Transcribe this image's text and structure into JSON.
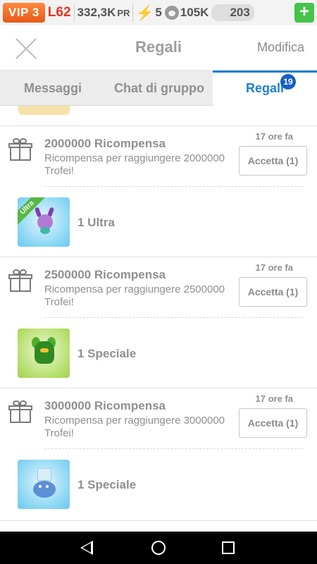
{
  "status": {
    "vip": "VIP 3",
    "level": "L62",
    "pr_value": "332,3K",
    "pr_unit": "PR",
    "energy": "5",
    "food": "105K",
    "coins": "203",
    "plus": "+"
  },
  "header": {
    "title": "Regali",
    "edit_label": "Modifica"
  },
  "tabs": [
    {
      "label": "Messaggi",
      "active": false
    },
    {
      "label": "Chat di gruppo",
      "active": false
    },
    {
      "label": "Regali",
      "active": true,
      "badge": "19"
    }
  ],
  "rewards": [
    {
      "title": "2000000 Ricompensa",
      "description": "Ricompensa per raggiungere 2000000 Trofei!",
      "time": "17 ore fa",
      "button": "Accetta (1)",
      "item_label": "1 Ultra",
      "item_tag": "Ultra",
      "icon": "purple-dragon-icon"
    },
    {
      "title": "2500000 Ricompensa",
      "description": "Ricompensa per raggiungere 2500000 Trofei!",
      "time": "17 ore fa",
      "button": "Accetta (1)",
      "item_label": "1 Speciale",
      "icon": "plant-dragon-icon"
    },
    {
      "title": "3000000 Ricompensa",
      "description": "Ricompensa per raggiungere 3000000 Trofei!",
      "time": "17 ore fa",
      "button": "Accetta (1)",
      "item_label": "1 Speciale",
      "icon": "ice-dragon-icon"
    }
  ],
  "colors": {
    "accent": "#1f7fd6",
    "vip": "#e8581a",
    "plus": "#44c44a"
  }
}
